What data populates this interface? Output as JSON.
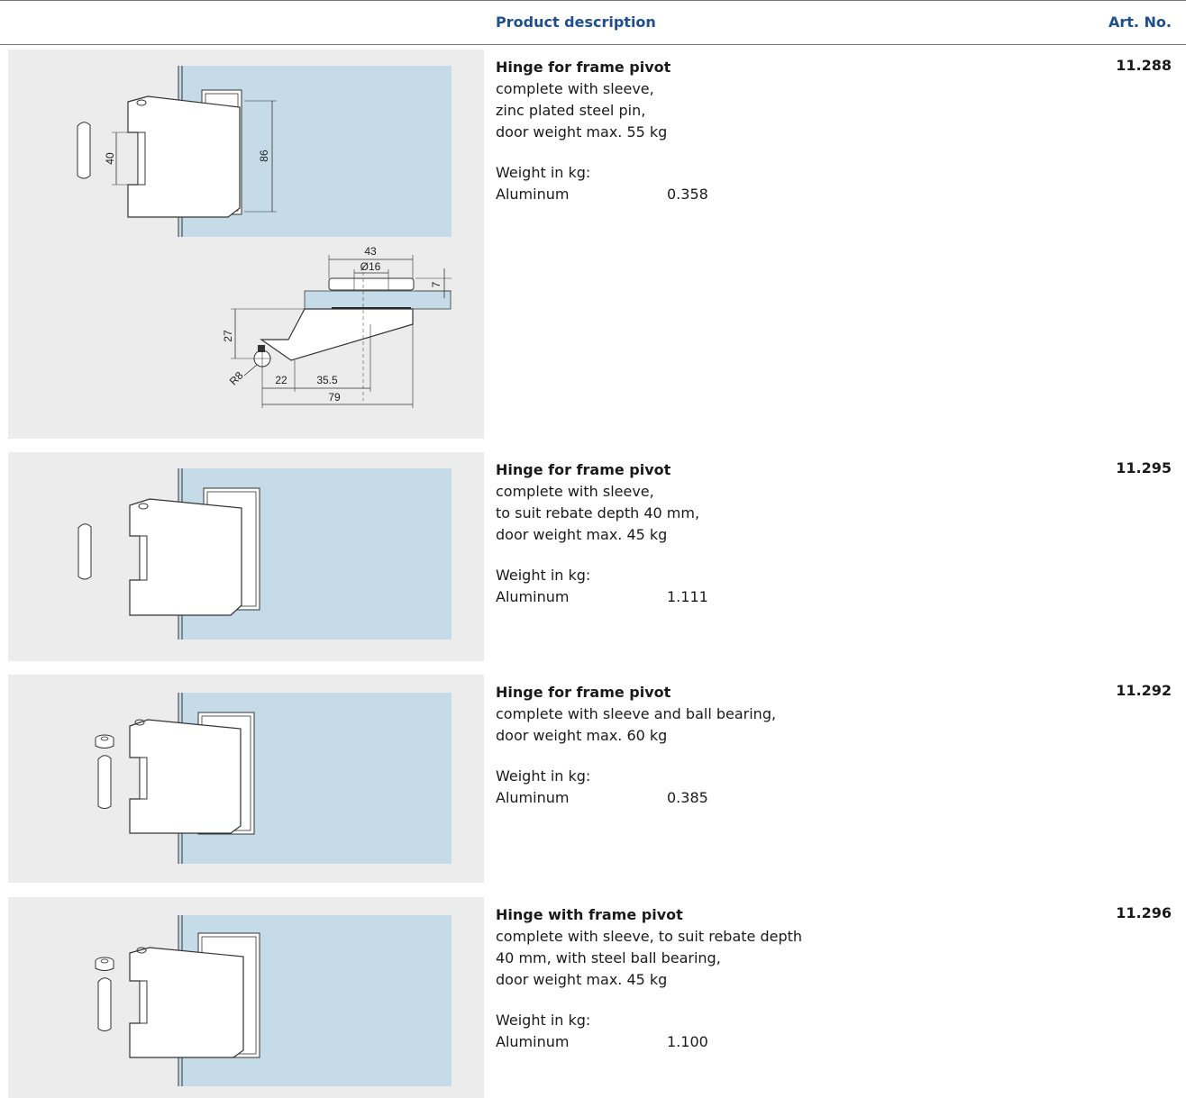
{
  "header": {
    "description_label": "Product description",
    "art_label": "Art. No."
  },
  "colors": {
    "header_text": "#1f4f8f",
    "image_background": "#ececec",
    "glass": "#c5dbe8"
  },
  "products": [
    {
      "title": "Hinge for frame pivot",
      "description": [
        "complete with sleeve,",
        "zinc plated steel pin,",
        "door weight max. 55 kg"
      ],
      "weight_label": "Weight in kg:",
      "material": "Aluminum",
      "weight": "0.358",
      "art_no": "11.288",
      "dimensions": {
        "pin_length": "40",
        "height": "86",
        "width": "43",
        "diameter": "Ø16",
        "plate_thickness": "7",
        "offset": "27",
        "radius": "R8",
        "dim_a": "22",
        "dim_b": "35.5",
        "dim_c": "79"
      }
    },
    {
      "title": "Hinge for frame pivot",
      "description": [
        "complete with sleeve,",
        "to suit rebate depth 40 mm,",
        "door weight max. 45 kg"
      ],
      "weight_label": "Weight in kg:",
      "material": "Aluminum",
      "weight": "1.111",
      "art_no": "11.295"
    },
    {
      "title": "Hinge for frame pivot",
      "description": [
        "complete with sleeve and ball bearing,",
        "door weight max. 60 kg"
      ],
      "weight_label": "Weight in kg:",
      "material": "Aluminum",
      "weight": "0.385",
      "art_no": "11.292"
    },
    {
      "title": "Hinge with frame pivot",
      "description": [
        "complete with sleeve, to suit rebate depth",
        "40 mm, with steel ball bearing,",
        "door weight max. 45 kg"
      ],
      "weight_label": "Weight in kg:",
      "material": "Aluminum",
      "weight": "1.100",
      "art_no": "11.296"
    }
  ]
}
